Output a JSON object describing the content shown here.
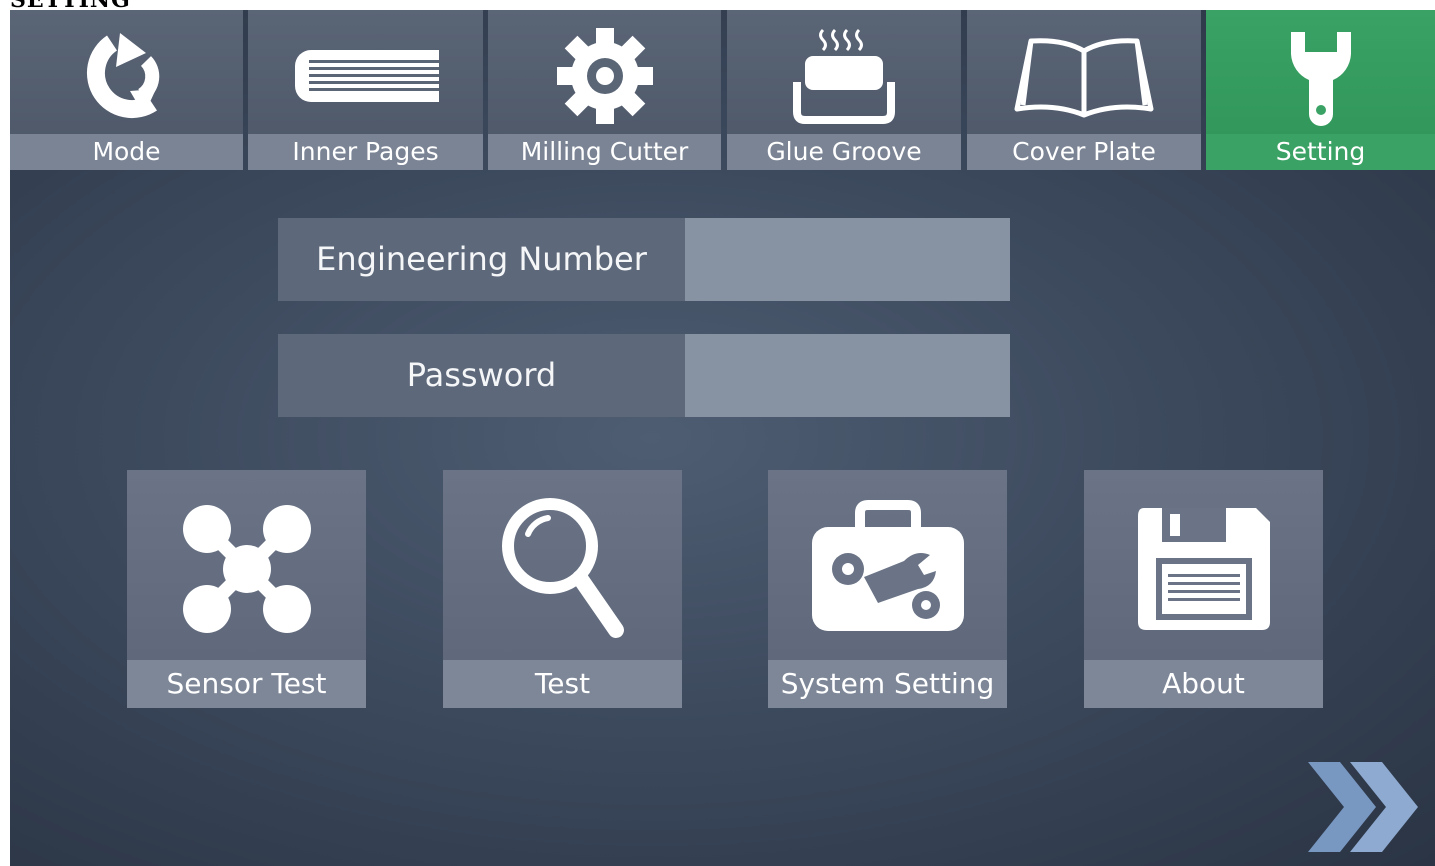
{
  "page_heading": "SETTING",
  "nav": {
    "items": [
      {
        "label": "Mode",
        "icon": "rotate-icon"
      },
      {
        "label": "Inner Pages",
        "icon": "book-pages-icon"
      },
      {
        "label": "Milling Cutter",
        "icon": "gear-icon"
      },
      {
        "label": "Glue Groove",
        "icon": "glue-pot-icon"
      },
      {
        "label": "Cover Plate",
        "icon": "open-book-icon"
      },
      {
        "label": "Setting",
        "icon": "wrench-icon"
      }
    ],
    "active": "Setting",
    "active_color": "#3aa265"
  },
  "login": {
    "engineering_number_label": "Engineering Number",
    "engineering_number_value": "",
    "password_label": "Password",
    "password_value": ""
  },
  "tiles": [
    {
      "label": "Sensor Test",
      "icon": "sensor-network-icon"
    },
    {
      "label": "Test",
      "icon": "magnifier-icon"
    },
    {
      "label": "System Setting",
      "icon": "toolbox-icon"
    },
    {
      "label": "About",
      "icon": "floppy-disk-icon"
    }
  ],
  "next_icon": "double-chevron-right-icon",
  "colors": {
    "background": "#3d4a5e",
    "tile": "#5c6678",
    "label_bar": "#7a8494"
  }
}
